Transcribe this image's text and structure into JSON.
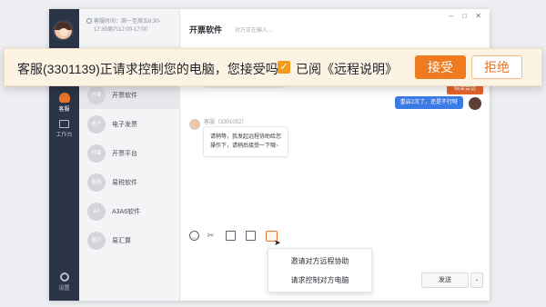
{
  "nav": {
    "kefu_label": "客服",
    "work_label": "工作台",
    "settings_label": "设置"
  },
  "service_hours": {
    "line1": "客服时间：周一至周五8:30-",
    "line2": "17:30周六12:00-17:00"
  },
  "contacts": [
    {
      "initials": "开票",
      "name": "开票软件"
    },
    {
      "initials": "电子",
      "name": "电子发票"
    },
    {
      "initials": "开票",
      "name": "开票平台"
    },
    {
      "initials": "易税",
      "name": "易税软件"
    },
    {
      "initials": "A3",
      "name": "A3A6软件"
    },
    {
      "initials": "易汇",
      "name": "易汇算"
    }
  ],
  "chat": {
    "title": "开票软件",
    "typing": "对方正在输入...",
    "end_button": "结束会话",
    "self_message": "重启2次了，还是不行呀",
    "agent_name": "客服（3301052）",
    "agent_message": "请稍等，我发起远程协助给您操作下，请稍后接受一下哦~"
  },
  "popup": {
    "items": [
      "邀请对方远程协助",
      "请求控制对方电脑"
    ]
  },
  "send_label": "发送",
  "consent": {
    "question": "客服(3301139)正请求控制您的电脑，您接受吗？",
    "checkbox_label": "已阅《远程说明》",
    "checked": true,
    "accept_label": "接受",
    "reject_label": "拒绝"
  },
  "colors": {
    "accent": "#f07b1e",
    "nav_bg": "#2b3346",
    "banner_bg": "#fdf3e3",
    "self_bubble": "#3b7be6"
  }
}
